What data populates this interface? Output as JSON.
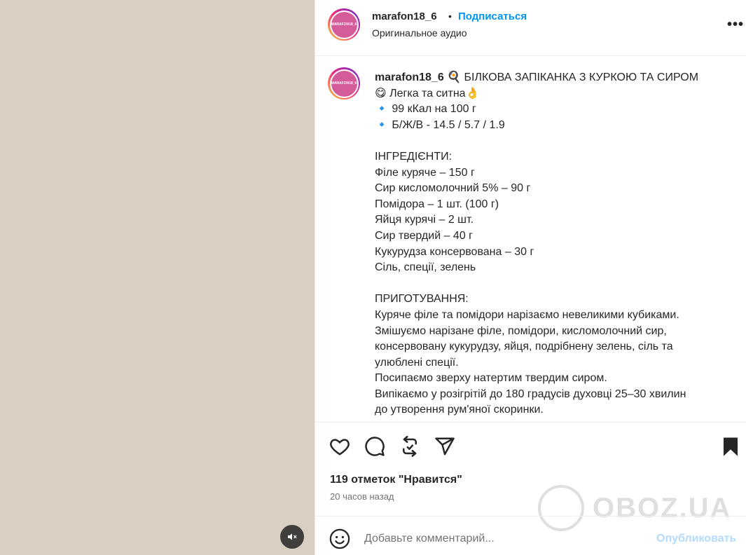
{
  "media": {
    "mute_icon": "volume-muted-icon"
  },
  "header": {
    "avatar_text": "MARAFON18_6",
    "username": "marafon18_6",
    "separator": "•",
    "follow_label": "Подписаться",
    "audio_label": "Оригинальное аудио",
    "more_label": "•••"
  },
  "caption": {
    "username": "marafon18_6",
    "lines": [
      "🍳 БІЛКОВА ЗАПІКАНКА З КУРКОЮ ТА СИРОМ",
      "😋 Легка та ситна👌",
      "🔹 99 кКал на 100 г",
      "🔹 Б/Ж/В - 14.5 / 5.7 / 1.9",
      "",
      "ІНГРЕДІЄНТИ:",
      "Філе куряче – 150 г",
      "Сир кисломолочний 5% – 90 г",
      "Помідора – 1 шт. (100 г)",
      "Яйця курячі – 2 шт.",
      "Сир твердий – 40 г",
      "Кукурудза консервована – 30 г",
      "Сіль, спеції, зелень",
      "",
      "ПРИГОТУВАННЯ:",
      "Куряче філе та помідори нарізаємо невеликими кубиками.",
      "Змішуємо нарізане філе, помідори, кисломолочний сир,",
      "консервовану кукурудзу, яйця, подрібнену зелень, сіль та",
      "улюблені спеції.",
      "Посипаємо зверху натертим твердим сиром.",
      "Випікаємо у розігрітій до 180 градусів духовці 25–30 хвилин",
      "до утворення рум'яної скоринки."
    ]
  },
  "actions": {
    "like_icon": "heart-icon",
    "comment_icon": "comment-icon",
    "repost_icon": "repost-icon",
    "share_icon": "share-icon",
    "save_icon": "bookmark-icon"
  },
  "likes_text": "119 отметок \"Нравится\"",
  "time_text": "20 часов назад",
  "watermark_text": "OBOZ.UA",
  "comment": {
    "placeholder": "Добавьте комментарий...",
    "publish_label": "Опубликовать",
    "emoji_icon": "emoji-icon"
  },
  "colors": {
    "link": "#0095f6",
    "publish_disabled": "#b3dbff",
    "muted_text": "#737373"
  }
}
